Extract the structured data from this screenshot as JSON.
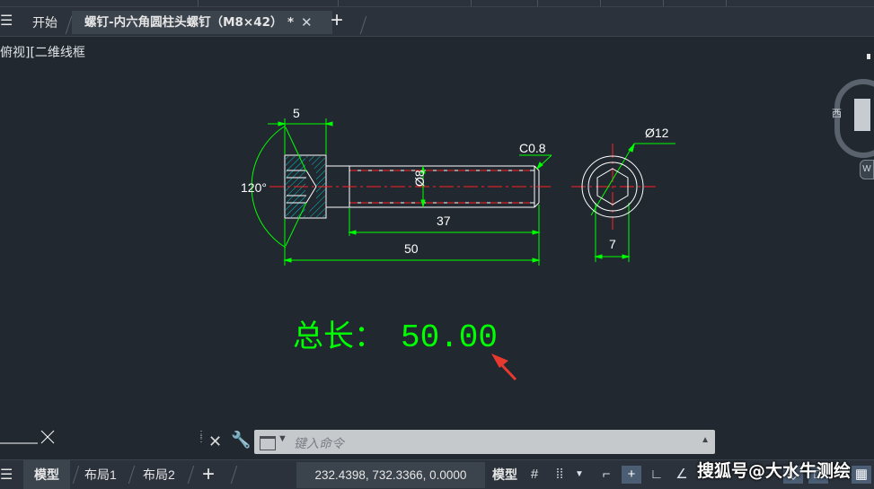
{
  "tabs": {
    "start": "开始",
    "active": "螺钉-内六角圆柱头螺钉（M8×42）",
    "modified_marker": "*"
  },
  "viewport": {
    "label": "俯视][二维线框"
  },
  "navcube": {
    "face_west": "西",
    "wcs": "W"
  },
  "drawing": {
    "dim_head_length": "5",
    "dim_angle": "120°",
    "dim_chamfer": "C0.8",
    "dim_thread_dia": "Ø8",
    "dim_thread_length": "37",
    "dim_total_length": "50",
    "dim_head_dia": "Ø12",
    "dim_hex_size": "7",
    "total_prefix": "总长：",
    "total_value": "50.00",
    "color_line": "#ffffff",
    "color_dim": "#00ff00",
    "color_center": "#ff0000",
    "color_hatch": "#00c8c8"
  },
  "command": {
    "placeholder": "键入命令"
  },
  "status": {
    "model_tab": "模型",
    "layout1": "布局1",
    "layout2": "布局2",
    "coordinates": "232.4398, 732.3366, 0.0000",
    "mode": "模型"
  },
  "watermark": "搜狐号@大水牛测绘"
}
